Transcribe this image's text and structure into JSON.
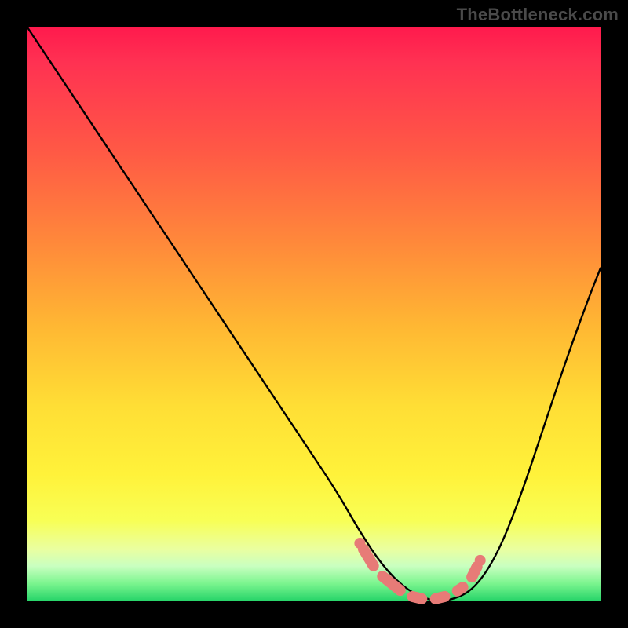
{
  "watermark": "TheBottleneck.com",
  "chart_data": {
    "type": "line",
    "title": "",
    "xlabel": "",
    "ylabel": "",
    "xlim": [
      0,
      100
    ],
    "ylim": [
      0,
      100
    ],
    "grid": false,
    "legend": false,
    "background_gradient": {
      "stops": [
        {
          "pos": 0.0,
          "color": "#ff1a4d"
        },
        {
          "pos": 0.5,
          "color": "#ffc236"
        },
        {
          "pos": 0.8,
          "color": "#fff23a"
        },
        {
          "pos": 1.0,
          "color": "#28d56a"
        }
      ]
    },
    "series": [
      {
        "name": "curve",
        "color": "#000000",
        "x": [
          0,
          6,
          12,
          18,
          24,
          30,
          36,
          42,
          48,
          54,
          58,
          62,
          66,
          70,
          74,
          78,
          82,
          86,
          90,
          94,
          98,
          100
        ],
        "y": [
          100,
          91,
          82,
          73,
          64,
          55,
          46,
          37,
          28,
          19,
          12,
          6,
          2,
          0,
          0,
          2,
          8,
          18,
          30,
          42,
          53,
          58
        ]
      },
      {
        "name": "marker-band",
        "type": "scatter",
        "color": "#e77b77",
        "points": [
          {
            "x": 58,
            "y": 10
          },
          {
            "x": 61,
            "y": 5
          },
          {
            "x": 66,
            "y": 1
          },
          {
            "x": 70,
            "y": 0
          },
          {
            "x": 74,
            "y": 1
          },
          {
            "x": 77,
            "y": 3
          },
          {
            "x": 79,
            "y": 7
          }
        ]
      }
    ]
  }
}
